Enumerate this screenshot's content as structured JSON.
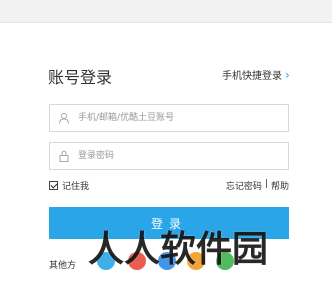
{
  "header": {
    "title": "账号登录",
    "quick_login": "手机快捷登录"
  },
  "form": {
    "account_placeholder": "手机/邮箱/优酷土豆账号",
    "password_placeholder": "登录密码",
    "remember_label": "记住我",
    "forgot_label": "忘记密码",
    "separator": "|",
    "help_label": "帮助",
    "login_label": "登录"
  },
  "footer": {
    "other_methods": "其他方"
  },
  "watermark": "人人软件园",
  "colors": {
    "accent": "#2aa6e8"
  }
}
